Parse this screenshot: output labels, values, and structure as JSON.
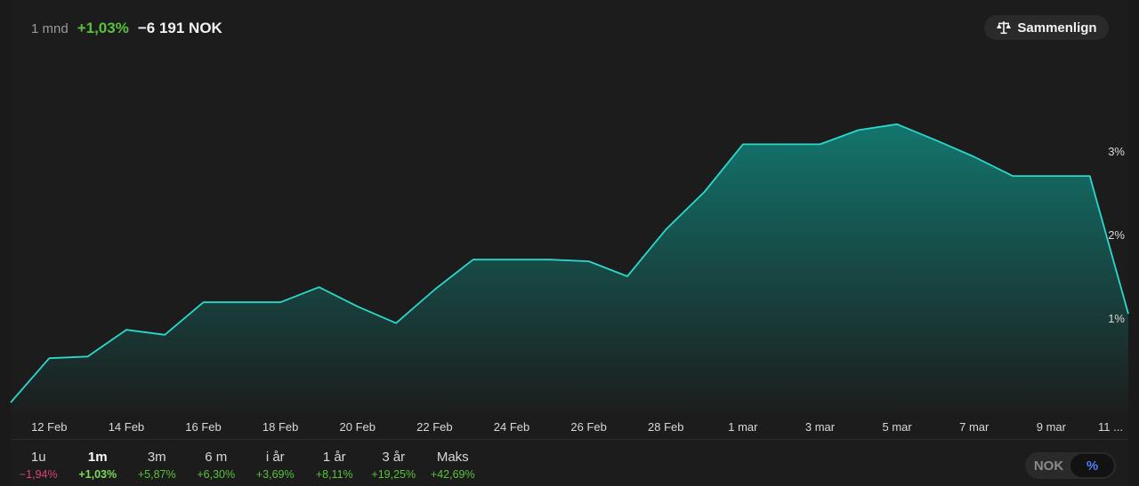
{
  "summary": {
    "period": "1 mnd",
    "pct": "+1,03%",
    "abs": "−6 191 NOK"
  },
  "compare": {
    "label": "Sammenlign",
    "icon": "scale-icon"
  },
  "colors": {
    "line": "#2ad8cc",
    "fill_top": "#127a72",
    "fill_bottom": "#1c1c1c",
    "positive": "#58c23a",
    "negative": "#e0407a",
    "toggle_active": "#4d7ef7"
  },
  "ranges": [
    {
      "label": "1u",
      "value": "−1,94%",
      "sign": "neg"
    },
    {
      "label": "1m",
      "value": "+1,03%",
      "sign": "pos",
      "active": true
    },
    {
      "label": "3m",
      "value": "+5,87%",
      "sign": "pos"
    },
    {
      "label": "6 m",
      "value": "+6,30%",
      "sign": "pos"
    },
    {
      "label": "i år",
      "value": "+3,69%",
      "sign": "pos"
    },
    {
      "label": "1 år",
      "value": "+8,11%",
      "sign": "pos"
    },
    {
      "label": "3 år",
      "value": "+19,25%",
      "sign": "pos"
    },
    {
      "label": "Maks",
      "value": "+42,69%",
      "sign": "pos"
    }
  ],
  "toggle": {
    "nok": "NOK",
    "pct": "%"
  },
  "chart_data": {
    "type": "area",
    "y_tick_labels": [
      "1%",
      "2%",
      "3%"
    ],
    "y_ticks": [
      1,
      2,
      3
    ],
    "x_tick_labels": [
      "12 Feb",
      "14 Feb",
      "16 Feb",
      "18 Feb",
      "20 Feb",
      "22 Feb",
      "24 Feb",
      "26 Feb",
      "28 Feb",
      "1 mar",
      "3 mar",
      "5 mar",
      "7 mar",
      "9 mar",
      "11 ..."
    ],
    "ylim": [
      -0.01,
      3.85
    ],
    "grid": false,
    "legend": "none",
    "values": [
      -0.01,
      0.52,
      0.54,
      0.86,
      0.8,
      1.19,
      1.19,
      1.19,
      1.37,
      1.14,
      0.94,
      1.34,
      1.7,
      1.7,
      1.7,
      1.68,
      1.5,
      2.06,
      2.51,
      3.08,
      3.08,
      3.08,
      3.25,
      3.32,
      3.13,
      2.93,
      2.7,
      2.7,
      2.7,
      1.05
    ]
  }
}
